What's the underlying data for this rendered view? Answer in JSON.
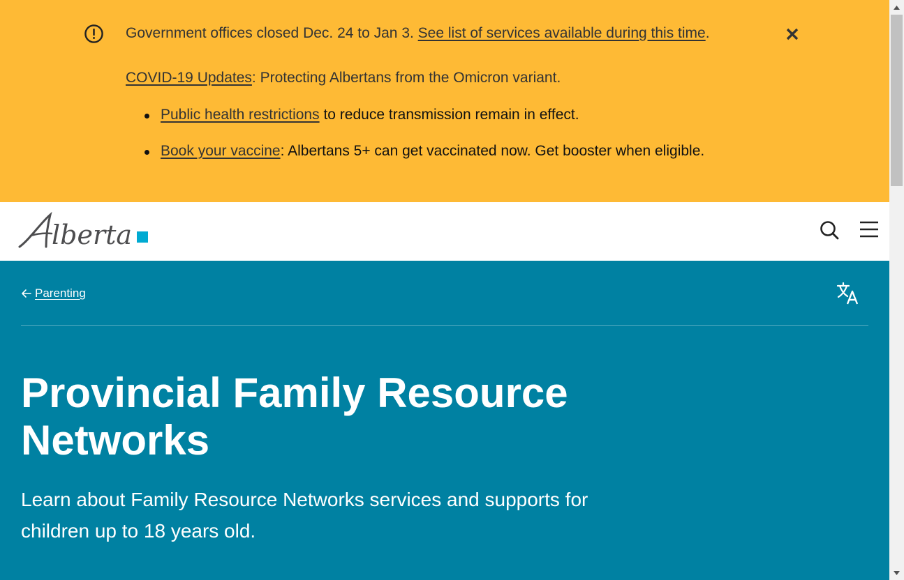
{
  "alert": {
    "line1_text": "Government offices closed Dec. 24 to Jan 3. ",
    "line1_link": "See list of services available during this time",
    "line1_end": ".",
    "line2_link": "COVID-19 Updates",
    "line2_text": ": Protecting Albertans from the Omicron variant.",
    "items": [
      {
        "link": "Public health restrictions",
        "text": " to reduce transmission remain in effect."
      },
      {
        "link": "Book your vaccine",
        "text": ": Albertans 5+ can get vaccinated now. Get booster when eligible."
      }
    ],
    "background_color": "#feba35"
  },
  "header": {
    "logo_text": "Alberta",
    "logo_accent_color": "#00aad2",
    "icons": [
      "search-icon",
      "menu-icon"
    ]
  },
  "hero": {
    "breadcrumb_label": "Parenting",
    "title": "Provincial Family Resource Networks",
    "lead": "Learn about Family Resource Networks services and supports for children up to 18 years old.",
    "background_color": "#0081a2",
    "translate_icon": "translate-icon"
  }
}
